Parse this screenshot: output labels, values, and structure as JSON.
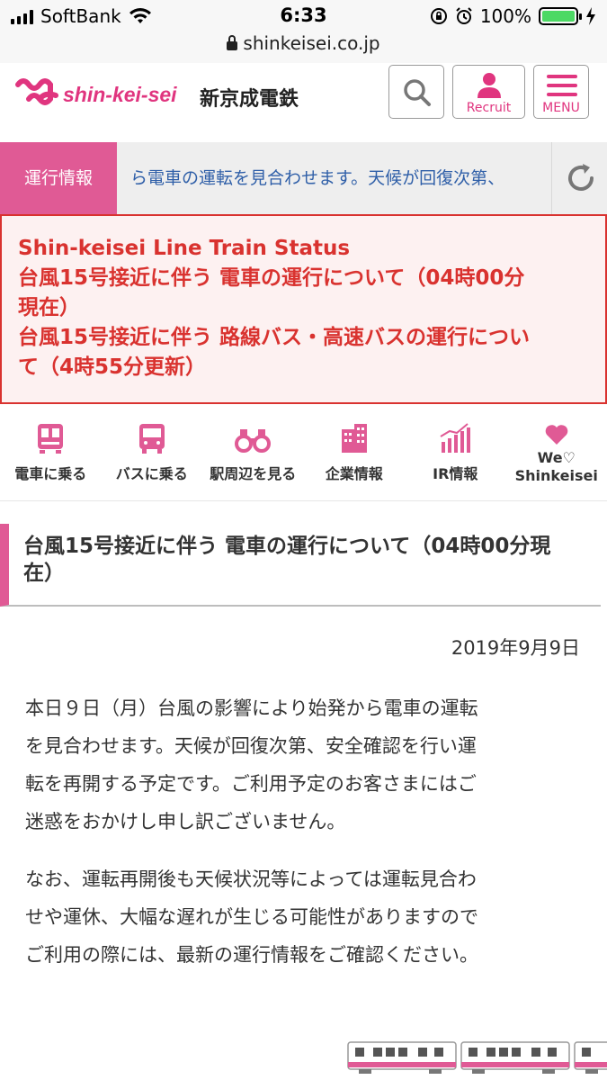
{
  "status_bar": {
    "carrier": "SoftBank",
    "time": "6:33",
    "battery": "100%",
    "battery_level": 1.0
  },
  "browser": {
    "url": "shinkeisei.co.jp"
  },
  "header": {
    "logo_text": "shin-kei-sei",
    "company_name": "新京成電鉄",
    "buttons": {
      "search_icon": "search-icon",
      "recruit_label": "Recruit",
      "menu_label": "MENU"
    }
  },
  "ticker": {
    "label": "運行情報",
    "text": "ら電車の運転を見合わせます。天候が回復次第、",
    "refresh_icon": "refresh-icon"
  },
  "alert": {
    "title": "Shin-keisei Line Train Status",
    "lines": [
      "台風15号接近に伴う 電車の運行について（04時00分",
      "現在）",
      "台風15号接近に伴う 路線バス・高速バスの運行につい",
      "て（4時55分更新）"
    ]
  },
  "nav": {
    "items": [
      {
        "label": "電車に乗る",
        "icon": "train-icon"
      },
      {
        "label": "バスに乗る",
        "icon": "bus-icon"
      },
      {
        "label": "駅周辺を見る",
        "icon": "binoculars-icon"
      },
      {
        "label": "企業情報",
        "icon": "building-icon"
      },
      {
        "label": "IR情報",
        "icon": "chart-icon"
      },
      {
        "label": "We♡",
        "label2": "Shinkeisei",
        "icon": "heart-icon"
      }
    ]
  },
  "article": {
    "title_line1": "台風15号接近に伴う 電車の運行について（04時00分現",
    "title_line2": "在）",
    "date": "2019年9月9日",
    "paragraph1": [
      "本日９日（月）台風の影響により始発から電車の運転",
      "を見合わせます。天候が回復次第、安全確認を行い運",
      "転を再開する予定です。ご利用予定のお客さまにはご",
      "迷惑をおかけし申し訳ございません。"
    ],
    "paragraph2": [
      "なお、運転再開後も天候状況等によっては運転見合わ",
      "せや運休、大幅な遅れが生じる可能性がありますので",
      "ご利用の際には、最新の運行情報をご確認ください。"
    ]
  },
  "colors": {
    "brand_pink": "#e05a95",
    "alert_red": "#d9322f",
    "ticker_blue": "#2f5fa8"
  }
}
